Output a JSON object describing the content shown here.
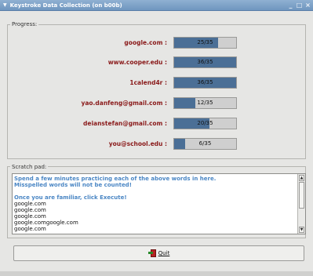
{
  "window": {
    "title": "Keystroke Data Collection (on b00b)"
  },
  "progress": {
    "label": "Progress:",
    "rows": [
      {
        "label": "google.com :",
        "value_text": "25/35",
        "fraction": 0.714
      },
      {
        "label": "www.cooper.edu :",
        "value_text": "36/35",
        "fraction": 1.0
      },
      {
        "label": "1calend4r :",
        "value_text": "36/35",
        "fraction": 1.0
      },
      {
        "label": "yao.danfeng@gmail.com :",
        "value_text": "12/35",
        "fraction": 0.343
      },
      {
        "label": "deianstefan@gmail.com :",
        "value_text": "20/35",
        "fraction": 0.571
      },
      {
        "label": "you@school.edu :",
        "value_text": "6/35",
        "fraction": 0.171
      }
    ]
  },
  "scratch": {
    "label": "Scratch pad:",
    "hint_lines": [
      "Spend a few minutes practicing each of the above words in here.",
      "Misspelled words will not be counted!",
      "",
      "Once you are familiar, click Execute!"
    ],
    "typed_lines": [
      "google.com",
      "google.com",
      "google.com",
      "google.comgoogle.com",
      "google.com"
    ]
  },
  "quit_label": "Quit",
  "colors": {
    "label_red": "#8a1a1a",
    "bar_fill": "#4b6f96",
    "hint_blue": "#4a86c4",
    "titlebar": "#7fa3ca"
  },
  "icons": {
    "menu": "triangle-down-icon",
    "minimize": "minimize-icon",
    "maximize": "maximize-icon",
    "close": "close-icon",
    "quit": "exit-door-icon"
  }
}
